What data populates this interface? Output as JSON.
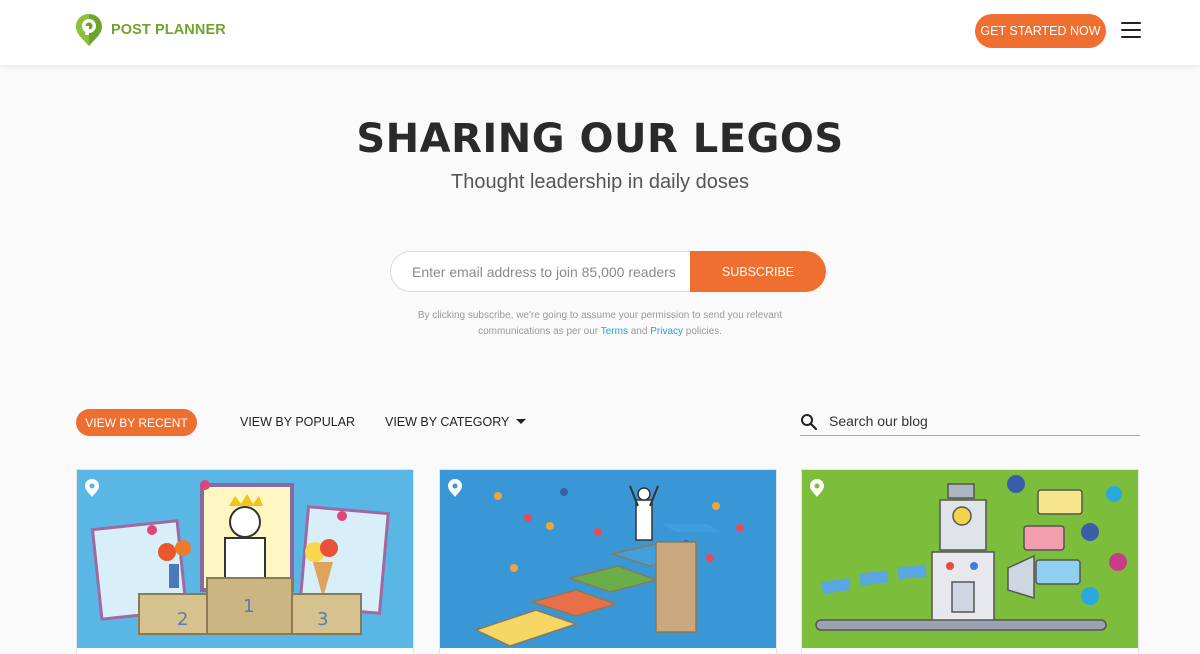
{
  "header": {
    "logo_text": "POST PLANNER",
    "cta_label": "GET STARTED NOW",
    "menu_icon": "hamburger-menu-icon"
  },
  "hero": {
    "title": "SHARING OUR LEGOS",
    "subtitle": "Thought leadership in daily doses"
  },
  "subscribe": {
    "placeholder": "Enter email address to join 85,000 readers",
    "button_label": "SUBSCRIBE",
    "consent_text_1": "By clicking subscribe, we're going to assume your permission to send you relevant communications as per our ",
    "terms_label": "Terms",
    "and_text": " and ",
    "privacy_label": "Privacy",
    "consent_text_2": " policies."
  },
  "filters": {
    "recent_label": "VIEW BY RECENT",
    "popular_label": "VIEW BY POPULAR",
    "category_label": "VIEW BY CATEGORY"
  },
  "search": {
    "placeholder": "Search our blog",
    "icon": "search-icon"
  },
  "cards": [
    {
      "illustration": "podium-with-photo-frames"
    },
    {
      "illustration": "scientist-on-staircase"
    },
    {
      "illustration": "lead-generating-robot"
    }
  ],
  "colors": {
    "accent": "#ef6f31",
    "brand_green": "#6fa32c",
    "link": "#2e9fd6",
    "card1_bg": "#5ab6e4",
    "card2_bg": "#3a97d6",
    "card3_bg": "#7cbd3c"
  }
}
